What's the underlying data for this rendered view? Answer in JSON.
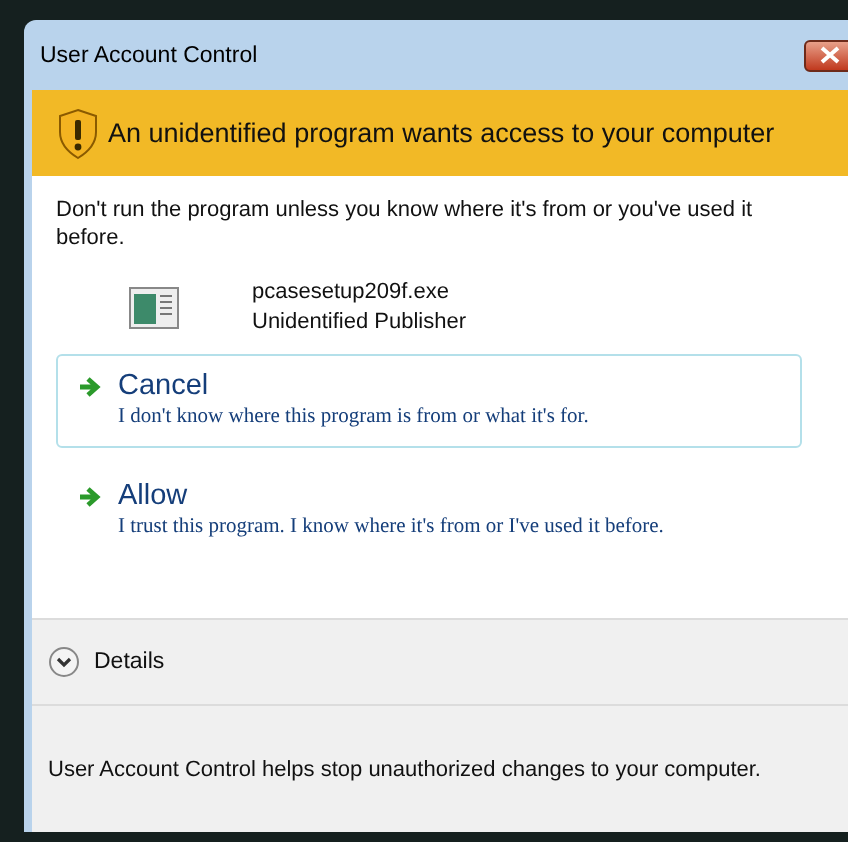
{
  "window": {
    "title": "User Account Control"
  },
  "banner": {
    "text": "An unidentified program wants access to your computer"
  },
  "message": "Don't run the program unless you know where it's from or you've used it before.",
  "program": {
    "name": "pcasesetup209f.exe",
    "publisher": "Unidentified Publisher"
  },
  "options": [
    {
      "label": "Cancel",
      "description": "I don't know where this program is from or what it's for.",
      "selected": true
    },
    {
      "label": "Allow",
      "description": "I trust this program. I know where it's from or I've used it before.",
      "selected": false
    }
  ],
  "details": {
    "label": "Details",
    "expanded": false
  },
  "footer": "User Account Control helps stop unauthorized changes to your computer."
}
